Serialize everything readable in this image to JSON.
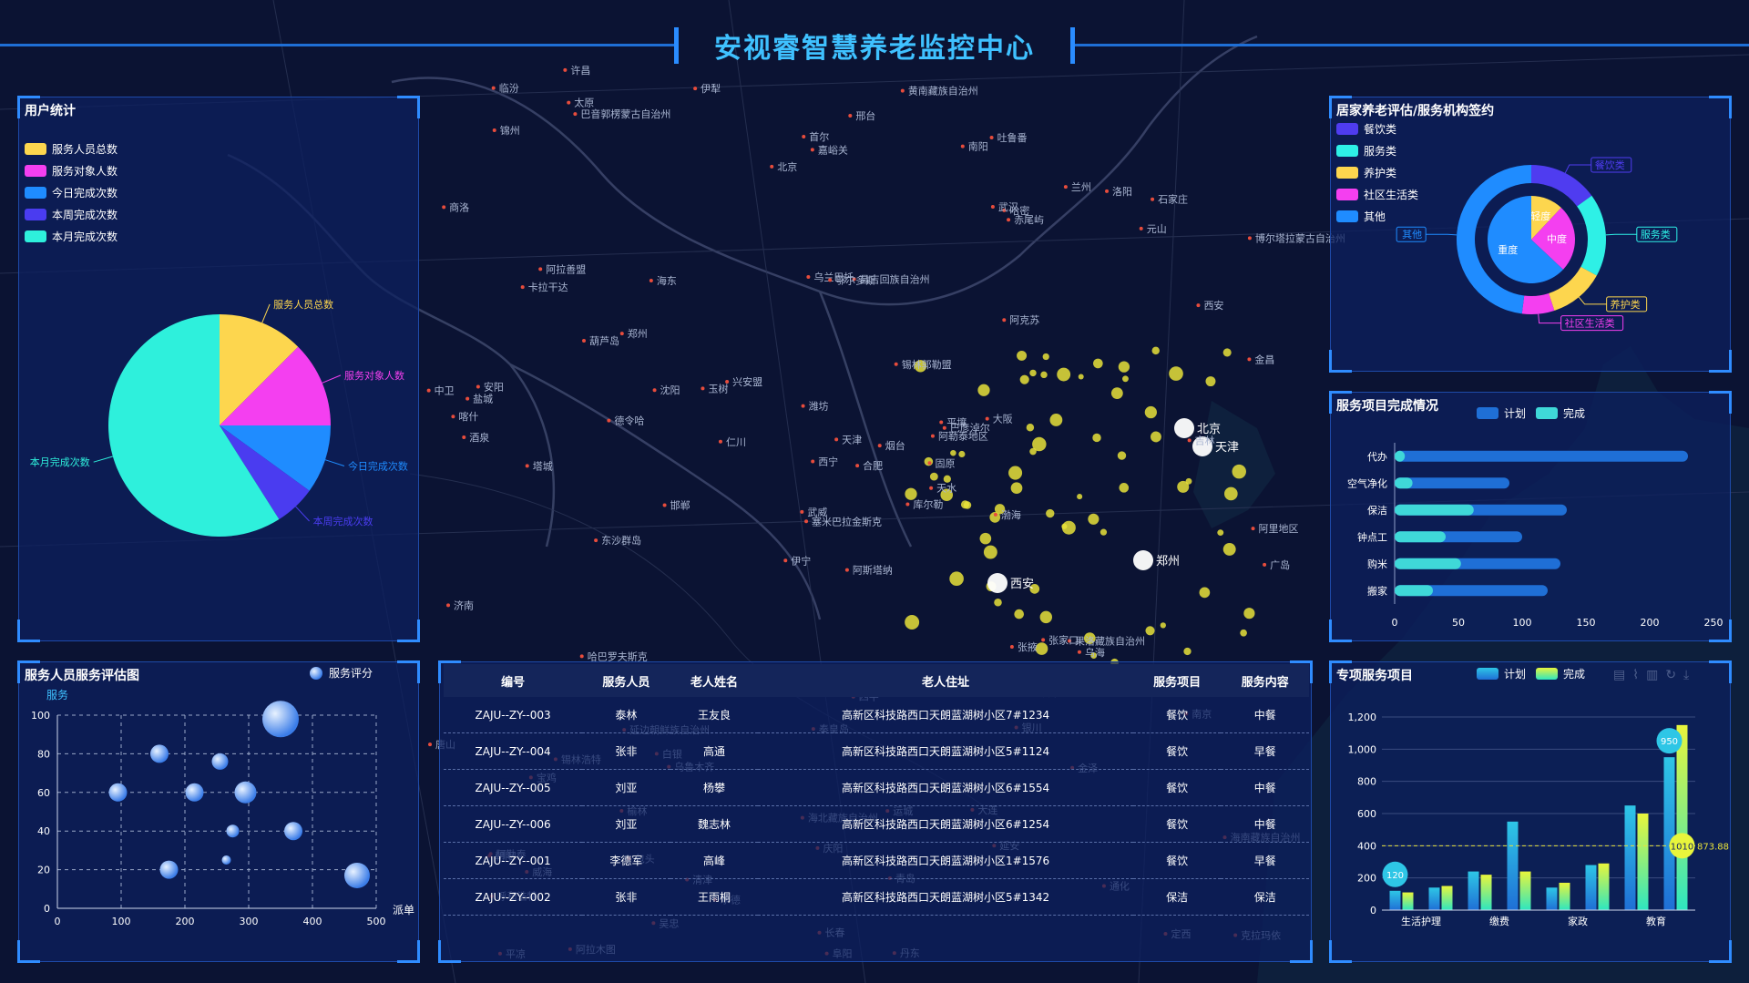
{
  "header": {
    "title": "安视睿智慧养老监控中心"
  },
  "map": {
    "labels": [
      "阿斯塔纳",
      "卡拉干达",
      "塞米巴拉金斯克",
      "阿勒泰",
      "阿勒泰地区",
      "乌鲁木齐",
      "吐鲁番",
      "昌吉回族自治州",
      "哈密",
      "库尔勒",
      "巴音郭楞蒙古自治州",
      "克拉玛依",
      "塔城",
      "博尔塔拉蒙古自治州",
      "伊宁",
      "阿克苏",
      "阿拉木图",
      "乌兰巴托",
      "锡林郭勒盟",
      "锡林浩特",
      "兴安盟",
      "呼和浩特",
      "包头",
      "鄂尔多斯",
      "巴彦淖尔",
      "乌海",
      "阿拉善盟",
      "嘉峪关",
      "酒泉",
      "张掖",
      "金昌",
      "武威",
      "海北藏族自治州",
      "西宁",
      "海东",
      "兰州",
      "白银",
      "定西",
      "海南藏族自治州",
      "果洛藏族自治州",
      "黄南藏族自治州",
      "玉树",
      "德令哈",
      "银川",
      "吴忠",
      "中卫",
      "固原",
      "平凉",
      "庆阳",
      "天水",
      "宝鸡",
      "西安",
      "商洛",
      "汉中",
      "延安",
      "榆林",
      "太原",
      "临汾",
      "运城",
      "石家庄",
      "邢台",
      "邯郸",
      "安阳",
      "郑州",
      "洛阳",
      "许昌",
      "南阳",
      "北京",
      "天津",
      "唐山",
      "秦皇岛",
      "承德",
      "张家口",
      "沈阳",
      "朝阳",
      "锦州",
      "葫芦岛",
      "济南",
      "潍坊",
      "青岛",
      "烟台",
      "威海",
      "渤海",
      "日本海",
      "长春",
      "吉林",
      "四平",
      "通化",
      "丹东",
      "大连",
      "首尔",
      "广岛",
      "大阪",
      "金泽",
      "合肥",
      "南京",
      "盐城",
      "阜阳",
      "武汉",
      "赤尾屿",
      "东沙群岛",
      "伊犁",
      "阿里地区",
      "喀什",
      "哈巴罗夫斯克",
      "延边朝鲜族自治州",
      "清津",
      "平壤",
      "元山",
      "仁川"
    ],
    "cities": [
      "北京",
      "天津",
      "郑州",
      "西安"
    ]
  },
  "user_stats": {
    "title": "用户统计",
    "legend": [
      {
        "label": "服务人员总数",
        "color": "#fdd64e"
      },
      {
        "label": "服务对象人数",
        "color": "#f43ff0"
      },
      {
        "label": "今日完成次数",
        "color": "#1f8cff"
      },
      {
        "label": "本周完成次数",
        "color": "#4a3cf0"
      },
      {
        "label": "本月完成次数",
        "color": "#2ef0dc"
      }
    ],
    "chart_data": {
      "type": "pie",
      "categories": [
        "服务人员总数",
        "服务对象人数",
        "今日完成次数",
        "本周完成次数",
        "本月完成次数"
      ],
      "values": [
        12.5,
        12.5,
        10,
        6,
        59
      ]
    }
  },
  "home_eval": {
    "title": "居家养老评估/服务机构签约",
    "legend": [
      {
        "label": "餐饮类",
        "color": "#4f3cf0"
      },
      {
        "label": "服务类",
        "color": "#2ef0e6"
      },
      {
        "label": "养护类",
        "color": "#fdd64e"
      },
      {
        "label": "社区生活类",
        "color": "#f43ff0"
      },
      {
        "label": "其他",
        "color": "#1f8cff"
      }
    ],
    "chart_data": {
      "type": "pie",
      "inner": {
        "categories": [
          "轻度",
          "中度",
          "重度"
        ],
        "values": [
          12,
          25,
          63
        ]
      },
      "outer": {
        "categories": [
          "餐饮类",
          "服务类",
          "养护类",
          "社区生活类",
          "其他"
        ],
        "values": [
          15,
          18,
          12,
          7,
          48
        ]
      }
    }
  },
  "service_completion": {
    "title": "服务项目完成情况",
    "legend_plan": "计划",
    "legend_done": "完成",
    "chart_data": {
      "type": "bar",
      "categories": [
        "代办",
        "空气净化",
        "保洁",
        "钟点工",
        "购米",
        "搬家"
      ],
      "series": [
        {
          "name": "计划",
          "values": [
            230,
            90,
            135,
            100,
            130,
            120
          ]
        },
        {
          "name": "完成",
          "values": [
            8,
            14,
            62,
            40,
            52,
            30
          ]
        }
      ],
      "xticks": [
        "0",
        "50",
        "100",
        "150",
        "200",
        "250"
      ],
      "xlim": [
        0,
        250
      ]
    }
  },
  "staff_rating": {
    "title": "服务人员服务评估图",
    "legend": "服务评分",
    "ylabel": "服务",
    "xlabel": "派单",
    "chart_data": {
      "type": "scatter",
      "xlim": [
        0,
        500
      ],
      "ylim": [
        0,
        100
      ],
      "xticks": [
        "0",
        "100",
        "200",
        "300",
        "400",
        "500"
      ],
      "yticks": [
        "0",
        "20",
        "40",
        "60",
        "80",
        "100"
      ],
      "points": [
        {
          "x": 350,
          "y": 98,
          "r": 20
        },
        {
          "x": 160,
          "y": 80,
          "r": 10
        },
        {
          "x": 255,
          "y": 76,
          "r": 9
        },
        {
          "x": 95,
          "y": 60,
          "r": 10
        },
        {
          "x": 215,
          "y": 60,
          "r": 10
        },
        {
          "x": 295,
          "y": 60,
          "r": 12
        },
        {
          "x": 275,
          "y": 40,
          "r": 7
        },
        {
          "x": 370,
          "y": 40,
          "r": 10
        },
        {
          "x": 175,
          "y": 20,
          "r": 10
        },
        {
          "x": 265,
          "y": 25,
          "r": 5
        },
        {
          "x": 470,
          "y": 17,
          "r": 14
        }
      ]
    }
  },
  "table": {
    "headers": [
      "编号",
      "服务人员",
      "老人姓名",
      "老人住址",
      "服务项目",
      "服务内容"
    ],
    "rows": [
      [
        "ZAJU--ZY--003",
        "泰林",
        "王友良",
        "高新区科技路西口天朗蓝湖树小区7#1234",
        "餐饮",
        "中餐"
      ],
      [
        "ZAJU--ZY--004",
        "张非",
        "高通",
        "高新区科技路西口天朗蓝湖树小区5#1124",
        "餐饮",
        "早餐"
      ],
      [
        "ZAJU--ZY--005",
        "刘亚",
        "杨攀",
        "高新区科技路西口天朗蓝湖树小区6#1554",
        "餐饮",
        "中餐"
      ],
      [
        "ZAJU--ZY--006",
        "刘亚",
        "魏志林",
        "高新区科技路西口天朗蓝湖树小区6#1254",
        "餐饮",
        "中餐"
      ],
      [
        "ZAJU--ZY--001",
        "李德军",
        "高峰",
        "高新区科技路西口天朗蓝湖树小区1#1576",
        "餐饮",
        "早餐"
      ],
      [
        "ZAJU--ZY--002",
        "张非",
        "王雨桐",
        "高新区科技路西口天朗蓝湖树小区5#1342",
        "保洁",
        "保洁"
      ]
    ]
  },
  "special_service": {
    "title": "专项服务项目",
    "legend_plan": "计划",
    "legend_done": "完成",
    "avg_label": "873.88",
    "chart_data": {
      "type": "bar",
      "categories": [
        "生活护理",
        "缴费",
        "家政",
        "教育"
      ],
      "ylim": [
        0,
        1200
      ],
      "yticks": [
        "0",
        "200",
        "400",
        "600",
        "800",
        "1,000",
        "1,200"
      ],
      "series": [
        {
          "name": "计划",
          "values": [
            120,
            140,
            240,
            550,
            140,
            280,
            650,
            950
          ]
        },
        {
          "name": "完成",
          "values": [
            110,
            150,
            220,
            240,
            170,
            290,
            600,
            1150
          ]
        }
      ],
      "markers": [
        {
          "label": "120",
          "series": "计划",
          "index": 0
        },
        {
          "label": "950",
          "series": "计划",
          "index": 7
        },
        {
          "label": "1010",
          "series": "完成",
          "index": 7
        }
      ]
    }
  }
}
